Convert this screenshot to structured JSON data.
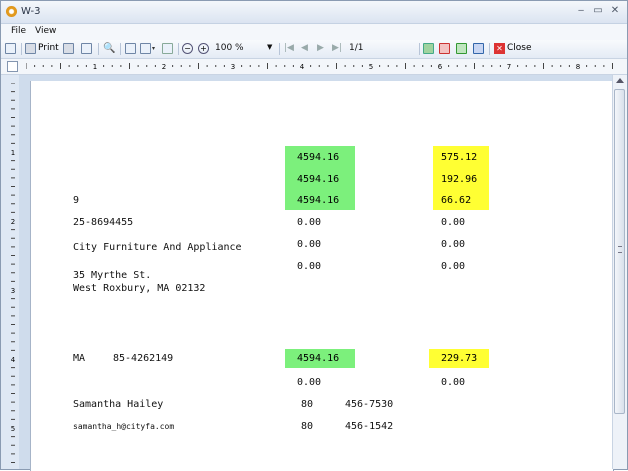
{
  "window": {
    "title": "W-3"
  },
  "menu": {
    "file": "File",
    "view": "View"
  },
  "toolbar": {
    "print_label": "Print",
    "zoom": "100 %",
    "page_indicator": "1/1",
    "close_label": "Close"
  },
  "ruler": {
    "h_numbers": [
      "1",
      "2",
      "3",
      "4",
      "5",
      "6",
      "7",
      "8"
    ],
    "v_numbers": [
      "1",
      "2",
      "3",
      "4",
      "5"
    ]
  },
  "form": {
    "box1_wages": "4594.16",
    "box3_ss_wages": "4594.16",
    "box5_medicare_wages": "4594.16",
    "box2_federal_tax": "575.12",
    "box4_ss_tax": "192.96",
    "box6_medicare_tax": "66.62",
    "kind_of_payer": "9",
    "employer_ein": "25-8694455",
    "employer_name": "City Furniture And Appliance",
    "employer_address_line1": "35 Myrthe St.",
    "employer_address_line2": "West Roxbury, MA 02132",
    "row1_left": "0.00",
    "row1_right": "0.00",
    "row2_left": "0.00",
    "row2_right": "0.00",
    "row3_left": "0.00",
    "row3_right": "0.00",
    "state": "MA",
    "state_id": "85-4262149",
    "state_wages": "4594.16",
    "state_tax": "229.73",
    "local_left": "0.00",
    "local_right": "0.00",
    "contact_name": "Samantha Hailey",
    "contact_email": "samantha_h@cityfa.com",
    "phone_area_1": "80",
    "phone_1": "456-7530",
    "phone_area_2": "80",
    "phone_2": "456-1542"
  }
}
